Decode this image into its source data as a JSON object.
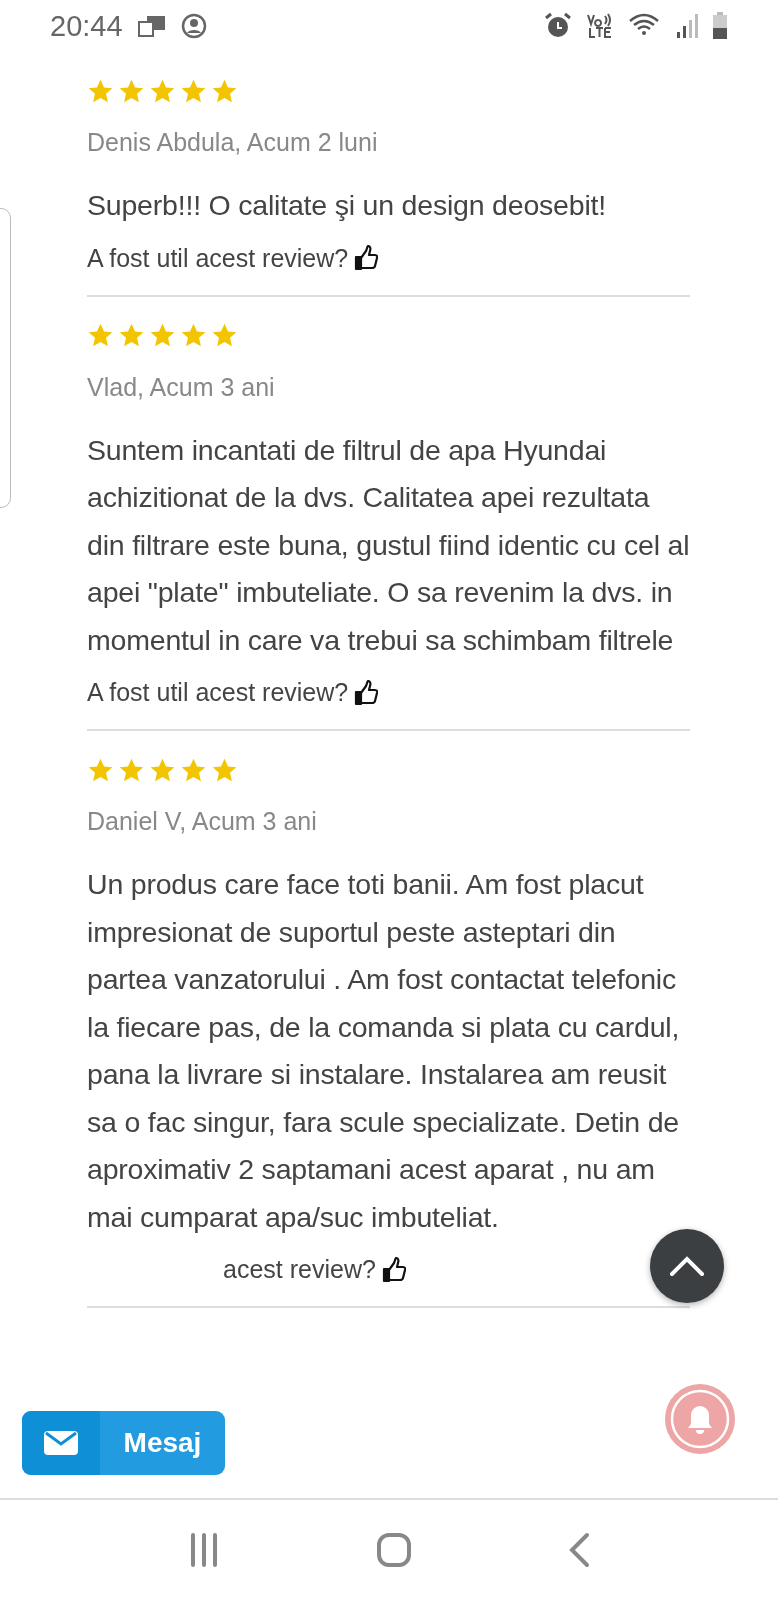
{
  "status_bar": {
    "time": "20:44"
  },
  "reviews": [
    {
      "stars": 5,
      "author": "Denis Abdula, Acum 2 luni",
      "text": "Superb!!! O calitate şi un design deosebit!",
      "helpful": "A fost util acest review?"
    },
    {
      "stars": 5,
      "author": "Vlad, Acum 3 ani",
      "text": "Suntem incantati de filtrul de apa Hyundai achizitionat de la dvs. Calitatea apei rezultata din filtrare este buna, gustul fiind identic cu cel al apei \"plate\" imbuteliate. O sa revenim la dvs. in momentul in care va trebui sa schimbam filtrele",
      "helpful": "A fost util acest review?"
    },
    {
      "stars": 5,
      "author": "Daniel V, Acum 3 ani",
      "text": "Un produs care face toti banii. Am fost placut impresionat de suportul peste asteptari din partea vanzatorului . Am fost contactat telefonic la fiecare pas, de la comanda si plata cu cardul, pana la livrare si instalare. Instalarea am reusit sa o fac singur, fara scule specializate. Detin de aproximativ 2 saptamani acest aparat , nu am mai cumparat apa/suc imbuteliat.",
      "helpful": "acest review?"
    }
  ],
  "message_button": {
    "label": "Mesaj"
  }
}
